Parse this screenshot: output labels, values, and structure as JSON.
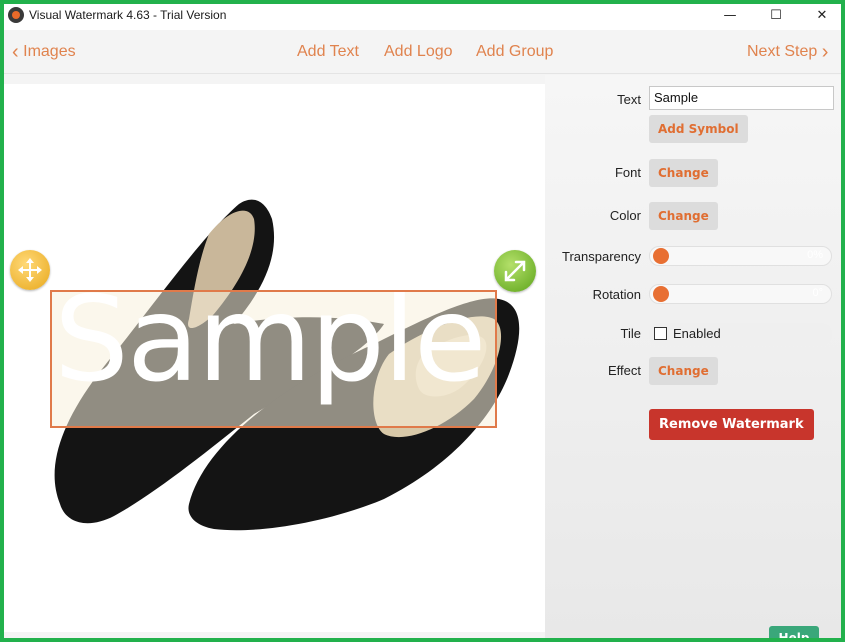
{
  "window": {
    "title": "Visual Watermark 4.63 - Trial Version",
    "controls": {
      "minimize": "—",
      "maximize": "☐",
      "close": "✕"
    }
  },
  "toolbar": {
    "back_label": "Images",
    "add_text": "Add Text",
    "add_logo": "Add Logo",
    "add_group": "Add Group",
    "next_label": "Next Step"
  },
  "canvas": {
    "watermark_text": "Sample"
  },
  "panel": {
    "text_label": "Text",
    "text_value": "Sample",
    "add_symbol": "Add Symbol",
    "font_label": "Font",
    "font_button": "Change",
    "color_label": "Color",
    "color_button": "Change",
    "transparency_label": "Transparency",
    "transparency_value": "0%",
    "rotation_label": "Rotation",
    "rotation_value": "0°",
    "tile_label": "Tile",
    "tile_enabled_label": "Enabled",
    "effect_label": "Effect",
    "effect_button": "Change",
    "remove_watermark": "Remove Watermark",
    "help": "Help"
  },
  "colors": {
    "accent": "#e06e32",
    "remove_button": "#c8352c",
    "help_button": "#3aa77a",
    "window_border": "#22b14c"
  },
  "icons": {
    "back": "chevron-left-icon",
    "next": "chevron-right-icon",
    "move": "move-arrows-icon",
    "resize": "resize-diagonal-icon"
  }
}
